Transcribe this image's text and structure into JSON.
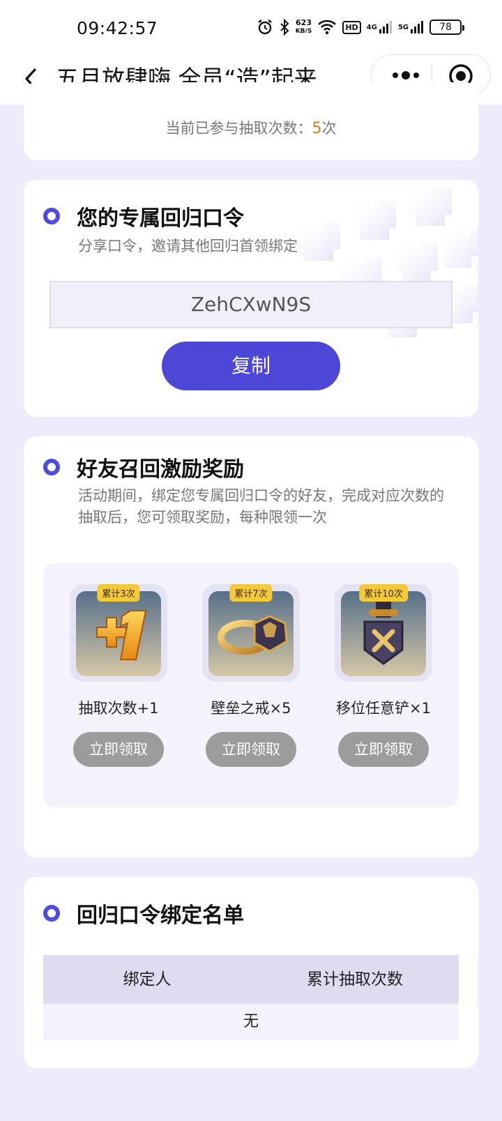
{
  "status_bar": {
    "time": "09:42:57",
    "speed_top": "623",
    "speed_unit": "KB/S",
    "hd": "HD",
    "net1": "4G",
    "net2": "5G",
    "battery": "78"
  },
  "nav": {
    "title": "五月放肆嗨 全员“造”起来"
  },
  "participation": {
    "label": "当前已参与抽取次数：",
    "count": "5",
    "unit": "次"
  },
  "code_section": {
    "title": "您的专属回归口令",
    "subtitle": "分享口令，邀请其他回归首领绑定",
    "code": "ZehCXwN9S",
    "copy_label": "复制"
  },
  "reward_section": {
    "title": "好友召回激励奖励",
    "subtitle": "活动期间，绑定您专属回归口令的好友，完成对应次数的抽取后，您可领取奖励，每种限领一次",
    "items": [
      {
        "badge": "累计3次",
        "name": "抽取次数+1",
        "button": "立即领取",
        "icon": "plus-one-icon"
      },
      {
        "badge": "累计7次",
        "name": "壁垒之戒×5",
        "button": "立即领取",
        "icon": "ring-icon"
      },
      {
        "badge": "累计10次",
        "name": "移位任意铲×1",
        "button": "立即领取",
        "icon": "shovel-icon"
      }
    ]
  },
  "binding_section": {
    "title": "回归口令绑定名单",
    "columns": [
      "绑定人",
      "累计抽取次数"
    ],
    "empty_text": "无"
  },
  "colors": {
    "accent": "#4d47d8",
    "highlight": "#e0781f",
    "badge": "#f5c93a",
    "disabled_button": "#9c9c9c"
  }
}
